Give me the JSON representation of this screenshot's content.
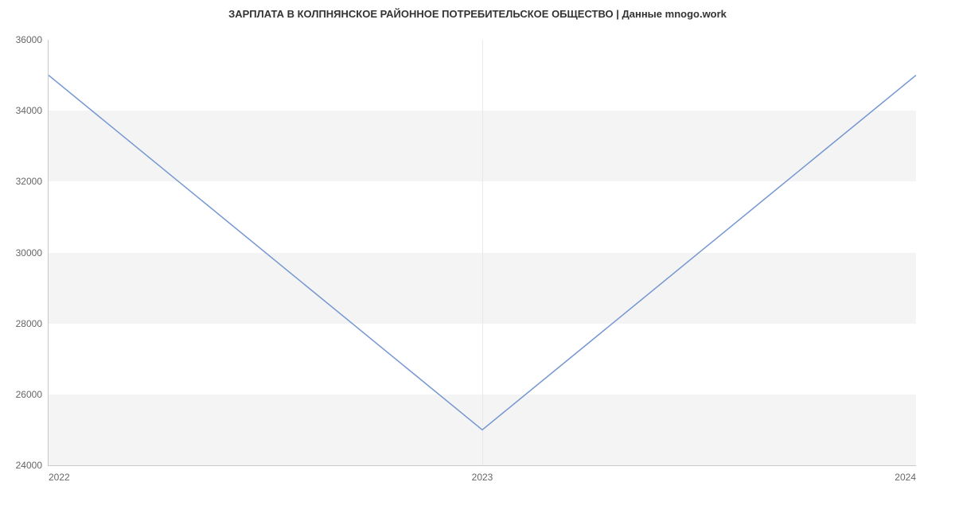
{
  "chart_data": {
    "type": "line",
    "title": "ЗАРПЛАТА В КОЛПНЯНСКОЕ РАЙОННОЕ ПОТРЕБИТЕЛЬСКОЕ ОБЩЕСТВО | Данные mnogo.work",
    "x": [
      "2022",
      "2023",
      "2024"
    ],
    "values": [
      35000,
      25000,
      35000
    ],
    "ylim": [
      24000,
      36000
    ],
    "yticks": [
      24000,
      26000,
      28000,
      30000,
      32000,
      34000,
      36000
    ],
    "xticks": [
      "2022",
      "2023",
      "2024"
    ],
    "line_color": "#7496d2",
    "band_color": "#f4f4f4"
  }
}
